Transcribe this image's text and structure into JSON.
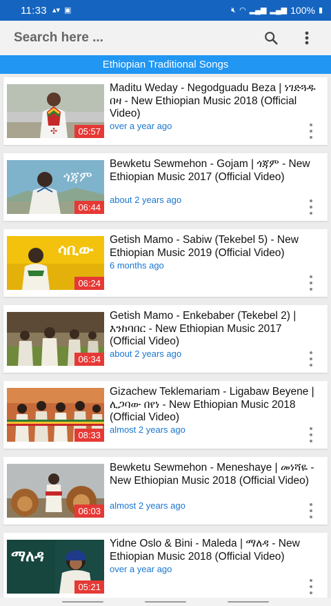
{
  "status_bar": {
    "time": "11:33",
    "battery": "100%"
  },
  "search": {
    "placeholder": "Search here ..."
  },
  "header": {
    "title": "Ethiopian Traditional Songs"
  },
  "videos": [
    {
      "title": "Maditu Weday - Negodguadu Beza | ነገድጓዱ በዛ - New Ethiopian Music 2018 (Official Video)",
      "age": "over a year ago",
      "duration": "05:57"
    },
    {
      "title": "Bewketu Sewmehon - Gojam | ጎጃም - New Ethiopian Music 2017 (Official Video)",
      "age": "about 2 years ago",
      "duration": "06:44"
    },
    {
      "title": "Getish Mamo - Sabiw (Tekebel 5) - New Ethiopian Music 2019 (Official Video)",
      "age": "6 months ago",
      "duration": "06:24"
    },
    {
      "title": "Getish Mamo - Enkebaber (Tekebel 2) | እንከባበር - New Ethiopian Music 2017 (Official Video)",
      "age": "about 2 years ago",
      "duration": "06:34"
    },
    {
      "title": "Gizachew Teklemariam - Ligabaw Beyene | ሊጋባው በየነ - New Ethiopian Music 2018 (Official Video)",
      "age": "almost 2 years ago",
      "duration": "08:33"
    },
    {
      "title": "Bewketu Sewmehon - Meneshaye | መነሻዬ - New Ethiopian Music 2018 (Official Video)",
      "age": "almost 2 years ago",
      "duration": "06:03"
    },
    {
      "title": "Yidne Oslo & Bini - Maleda | ማለዳ - New Ethiopian Music 2018 (Official Video)",
      "age": "over a year ago",
      "duration": "05:21"
    }
  ],
  "thumbnail_text": {
    "gojam": "ጎጃም",
    "sabiw": "ሳቢው",
    "maleda": "ማለዳ"
  }
}
